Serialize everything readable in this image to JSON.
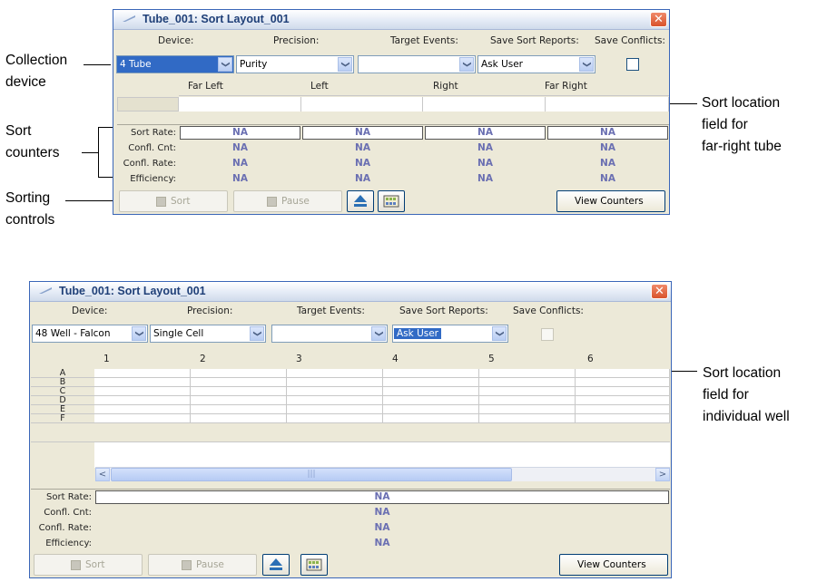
{
  "annotations": {
    "collection_device": [
      "Collection",
      "device"
    ],
    "sort_counters": [
      "Sort",
      "counters"
    ],
    "sorting_controls": [
      "Sorting",
      "controls"
    ],
    "sort_location_tube": [
      "Sort location",
      "field for",
      "far-right tube"
    ],
    "sort_location_well": [
      "Sort location",
      "field for",
      "individual well"
    ]
  },
  "window1": {
    "title": "Tube_001: Sort Layout_001",
    "close_glyph": "✕",
    "labels": {
      "device": "Device:",
      "precision": "Precision:",
      "target_events": "Target Events:",
      "save_sort_reports": "Save Sort Reports:",
      "save_conflicts": "Save Conflicts:"
    },
    "device_value": "4 Tube",
    "precision_value": "Purity",
    "target_events_value": "",
    "save_sort_reports_value": "Ask User",
    "save_conflicts_checked": false,
    "columns": [
      "Far Left",
      "Left",
      "Right",
      "Far Right"
    ],
    "counter_labels": [
      "Sort Rate:",
      "Confl. Cnt:",
      "Confl. Rate:",
      "Efficiency:"
    ],
    "counter_values": [
      [
        "NA",
        "NA",
        "NA",
        "NA"
      ],
      [
        "NA",
        "NA",
        "NA",
        "NA"
      ],
      [
        "NA",
        "NA",
        "NA",
        "NA"
      ],
      [
        "NA",
        "NA",
        "NA",
        "NA"
      ]
    ],
    "buttons": {
      "sort": "Sort",
      "pause": "Pause",
      "view_counters": "View Counters"
    }
  },
  "window2": {
    "title": "Tube_001: Sort Layout_001",
    "close_glyph": "✕",
    "labels": {
      "device": "Device:",
      "precision": "Precision:",
      "target_events": "Target Events:",
      "save_sort_reports": "Save Sort Reports:",
      "save_conflicts": "Save Conflicts:"
    },
    "device_value": "48 Well - Falcon",
    "precision_value": "Single Cell",
    "target_events_value": "",
    "save_sort_reports_value": "Ask User",
    "save_conflicts_checked": false,
    "columns": [
      "1",
      "2",
      "3",
      "4",
      "5",
      "6"
    ],
    "rows": [
      "A",
      "B",
      "C",
      "D",
      "E",
      "F"
    ],
    "scroll_thumb_grip": "|||",
    "counter_labels": [
      "Sort Rate:",
      "Confl. Cnt:",
      "Confl. Rate:",
      "Efficiency:"
    ],
    "counter_values": [
      "NA",
      "NA",
      "NA",
      "NA"
    ],
    "buttons": {
      "sort": "Sort",
      "pause": "Pause",
      "view_counters": "View Counters"
    }
  },
  "icons": {
    "dropdown_arrow": "❯",
    "scroll_left": "<",
    "scroll_right": ">"
  }
}
